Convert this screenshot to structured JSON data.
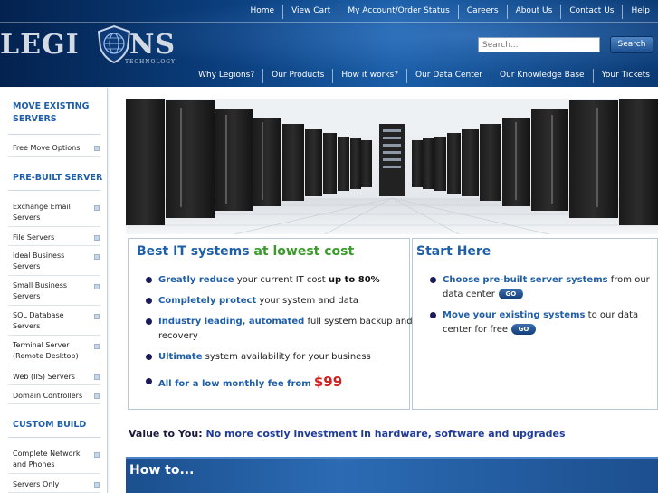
{
  "header": {
    "top_nav": [
      "Home",
      "View Cart",
      "My Account/Order Status",
      "Careers",
      "About Us",
      "Contact Us",
      "Help"
    ],
    "logo": {
      "left": "LEGI",
      "right": "NS",
      "tagline": "TECHNOLOGY"
    },
    "search": {
      "placeholder": "Search...",
      "button": "Search"
    },
    "sub_nav": [
      "Why Legions?",
      "Our Products",
      "How it works?",
      "Our Data Center",
      "Our Knowledge Base",
      "Your Tickets"
    ]
  },
  "sidebar": {
    "sections": [
      {
        "heading_l1": "MOVE EXISTING",
        "heading_l2": "SERVERS",
        "items": [
          {
            "l1": "Free Move Options",
            "l2": ""
          }
        ]
      },
      {
        "heading_l1": "PRE-BUILT SERVER",
        "heading_l2": "",
        "items": [
          {
            "l1": "Exchange Email",
            "l2": "Servers"
          },
          {
            "l1": "File Servers",
            "l2": ""
          },
          {
            "l1": "Ideal Business",
            "l2": "Servers"
          },
          {
            "l1": "Small Business",
            "l2": "Servers"
          },
          {
            "l1": "SQL Database",
            "l2": "Servers"
          },
          {
            "l1": "Terminal Server",
            "l2": "(Remote Desktop)"
          },
          {
            "l1": "Web (IIS) Servers",
            "l2": ""
          },
          {
            "l1": "Domain Controllers",
            "l2": ""
          }
        ]
      },
      {
        "heading_l1": "CUSTOM BUILD",
        "heading_l2": "",
        "items": [
          {
            "l1": "Complete Network",
            "l2": "and Phones"
          },
          {
            "l1": "Servers Only",
            "l2": ""
          }
        ]
      }
    ]
  },
  "left_box": {
    "title_blue": "Best IT systems",
    "title_green": "at lowest cost",
    "bullets": [
      {
        "a": "Greatly reduce",
        "b": " your current IT cost ",
        "c": "up to 80%",
        "d": ""
      },
      {
        "a": "Completely protect",
        "b": " your system and data",
        "c": "",
        "d": ""
      },
      {
        "a": "Industry leading, automated",
        "b": " full system backup and",
        "c": "",
        "d": "recovery"
      },
      {
        "a": "Ultimate",
        "b": " system availability for your business",
        "c": "",
        "d": ""
      },
      {
        "a": "All for a low monthly fee from",
        "b": "",
        "c": "$99",
        "d": ""
      }
    ]
  },
  "right_box": {
    "title": "Start Here",
    "bullets": [
      {
        "a": "Choose pre-built server systems",
        "b": " from our",
        "c": "data center"
      },
      {
        "a": "Move your existing systems",
        "b": " to our data",
        "c": "center for free"
      }
    ],
    "go_label": "GO"
  },
  "value": {
    "label": "Value to You:",
    "text": "No more costly investment in hardware, software and upgrades"
  },
  "howto": {
    "title": "How to..."
  },
  "colors": {
    "brand_blue": "#1f5ea8",
    "accent_green": "#3a9b2a",
    "price_red": "#d22020",
    "header_navy": "#0b3f7e"
  },
  "banner": {
    "image": "data-center-server-racks"
  }
}
